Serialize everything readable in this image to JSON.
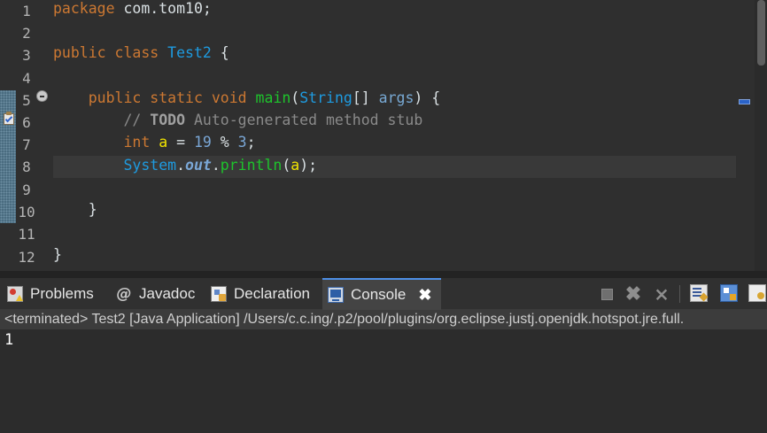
{
  "editor": {
    "line_numbers": [
      "1",
      "2",
      "3",
      "4",
      "5",
      "6",
      "7",
      "8",
      "9",
      "10",
      "11",
      "12"
    ],
    "code": {
      "l1_keyword": "package",
      "l1_rest": " com.tom10;",
      "l3_kw_public": "public",
      "l3_kw_class": "class",
      "l3_classname": "Test2",
      "l3_brace": " {",
      "l5_indent": "    ",
      "l5_kw_public": "public",
      "l5_kw_static": "static",
      "l5_kw_void": "void",
      "l5_method": "main",
      "l5_paren_open": "(",
      "l5_type": "String",
      "l5_brackets": "[] ",
      "l5_param": "args",
      "l5_end": ") {",
      "l6_indent": "        ",
      "l6_comment_start": "// ",
      "l6_todo": "TODO",
      "l6_comment_rest": " Auto-generated method stub",
      "l7_indent": "        ",
      "l7_kw_int": "int",
      "l7_var": "a",
      "l7_eq": " = ",
      "l7_num1": "19",
      "l7_op": " % ",
      "l7_num2": "3",
      "l7_semi": ";",
      "l8_indent": "        ",
      "l8_class": "System",
      "l8_dot1": ".",
      "l8_field": "out",
      "l8_dot2": ".",
      "l8_method": "println",
      "l8_open": "(",
      "l8_arg": "a",
      "l8_close": ");",
      "l10_indent": "    ",
      "l10_brace": "}",
      "l12_brace": "}"
    }
  },
  "console_view": {
    "tabs": [
      {
        "label": "Problems",
        "icon": "problems-icon"
      },
      {
        "label": "Javadoc",
        "icon": "javadoc-icon"
      },
      {
        "label": "Declaration",
        "icon": "declaration-icon"
      },
      {
        "label": "Console",
        "icon": "console-icon",
        "active": true
      }
    ],
    "close_glyph": "✖",
    "status": "<terminated> Test2 [Java Application] /Users/c.c.ing/.p2/pool/plugins/org.eclipse.justj.openjdk.hotspot.jre.full.",
    "output": "1"
  },
  "colors": {
    "background": "#2f2f2f",
    "keyword": "#cc7832",
    "type": "#1e9be0",
    "method": "#1ec42c",
    "local_var": "#f0e300",
    "active_tab_accent": "#4d8fe6"
  }
}
